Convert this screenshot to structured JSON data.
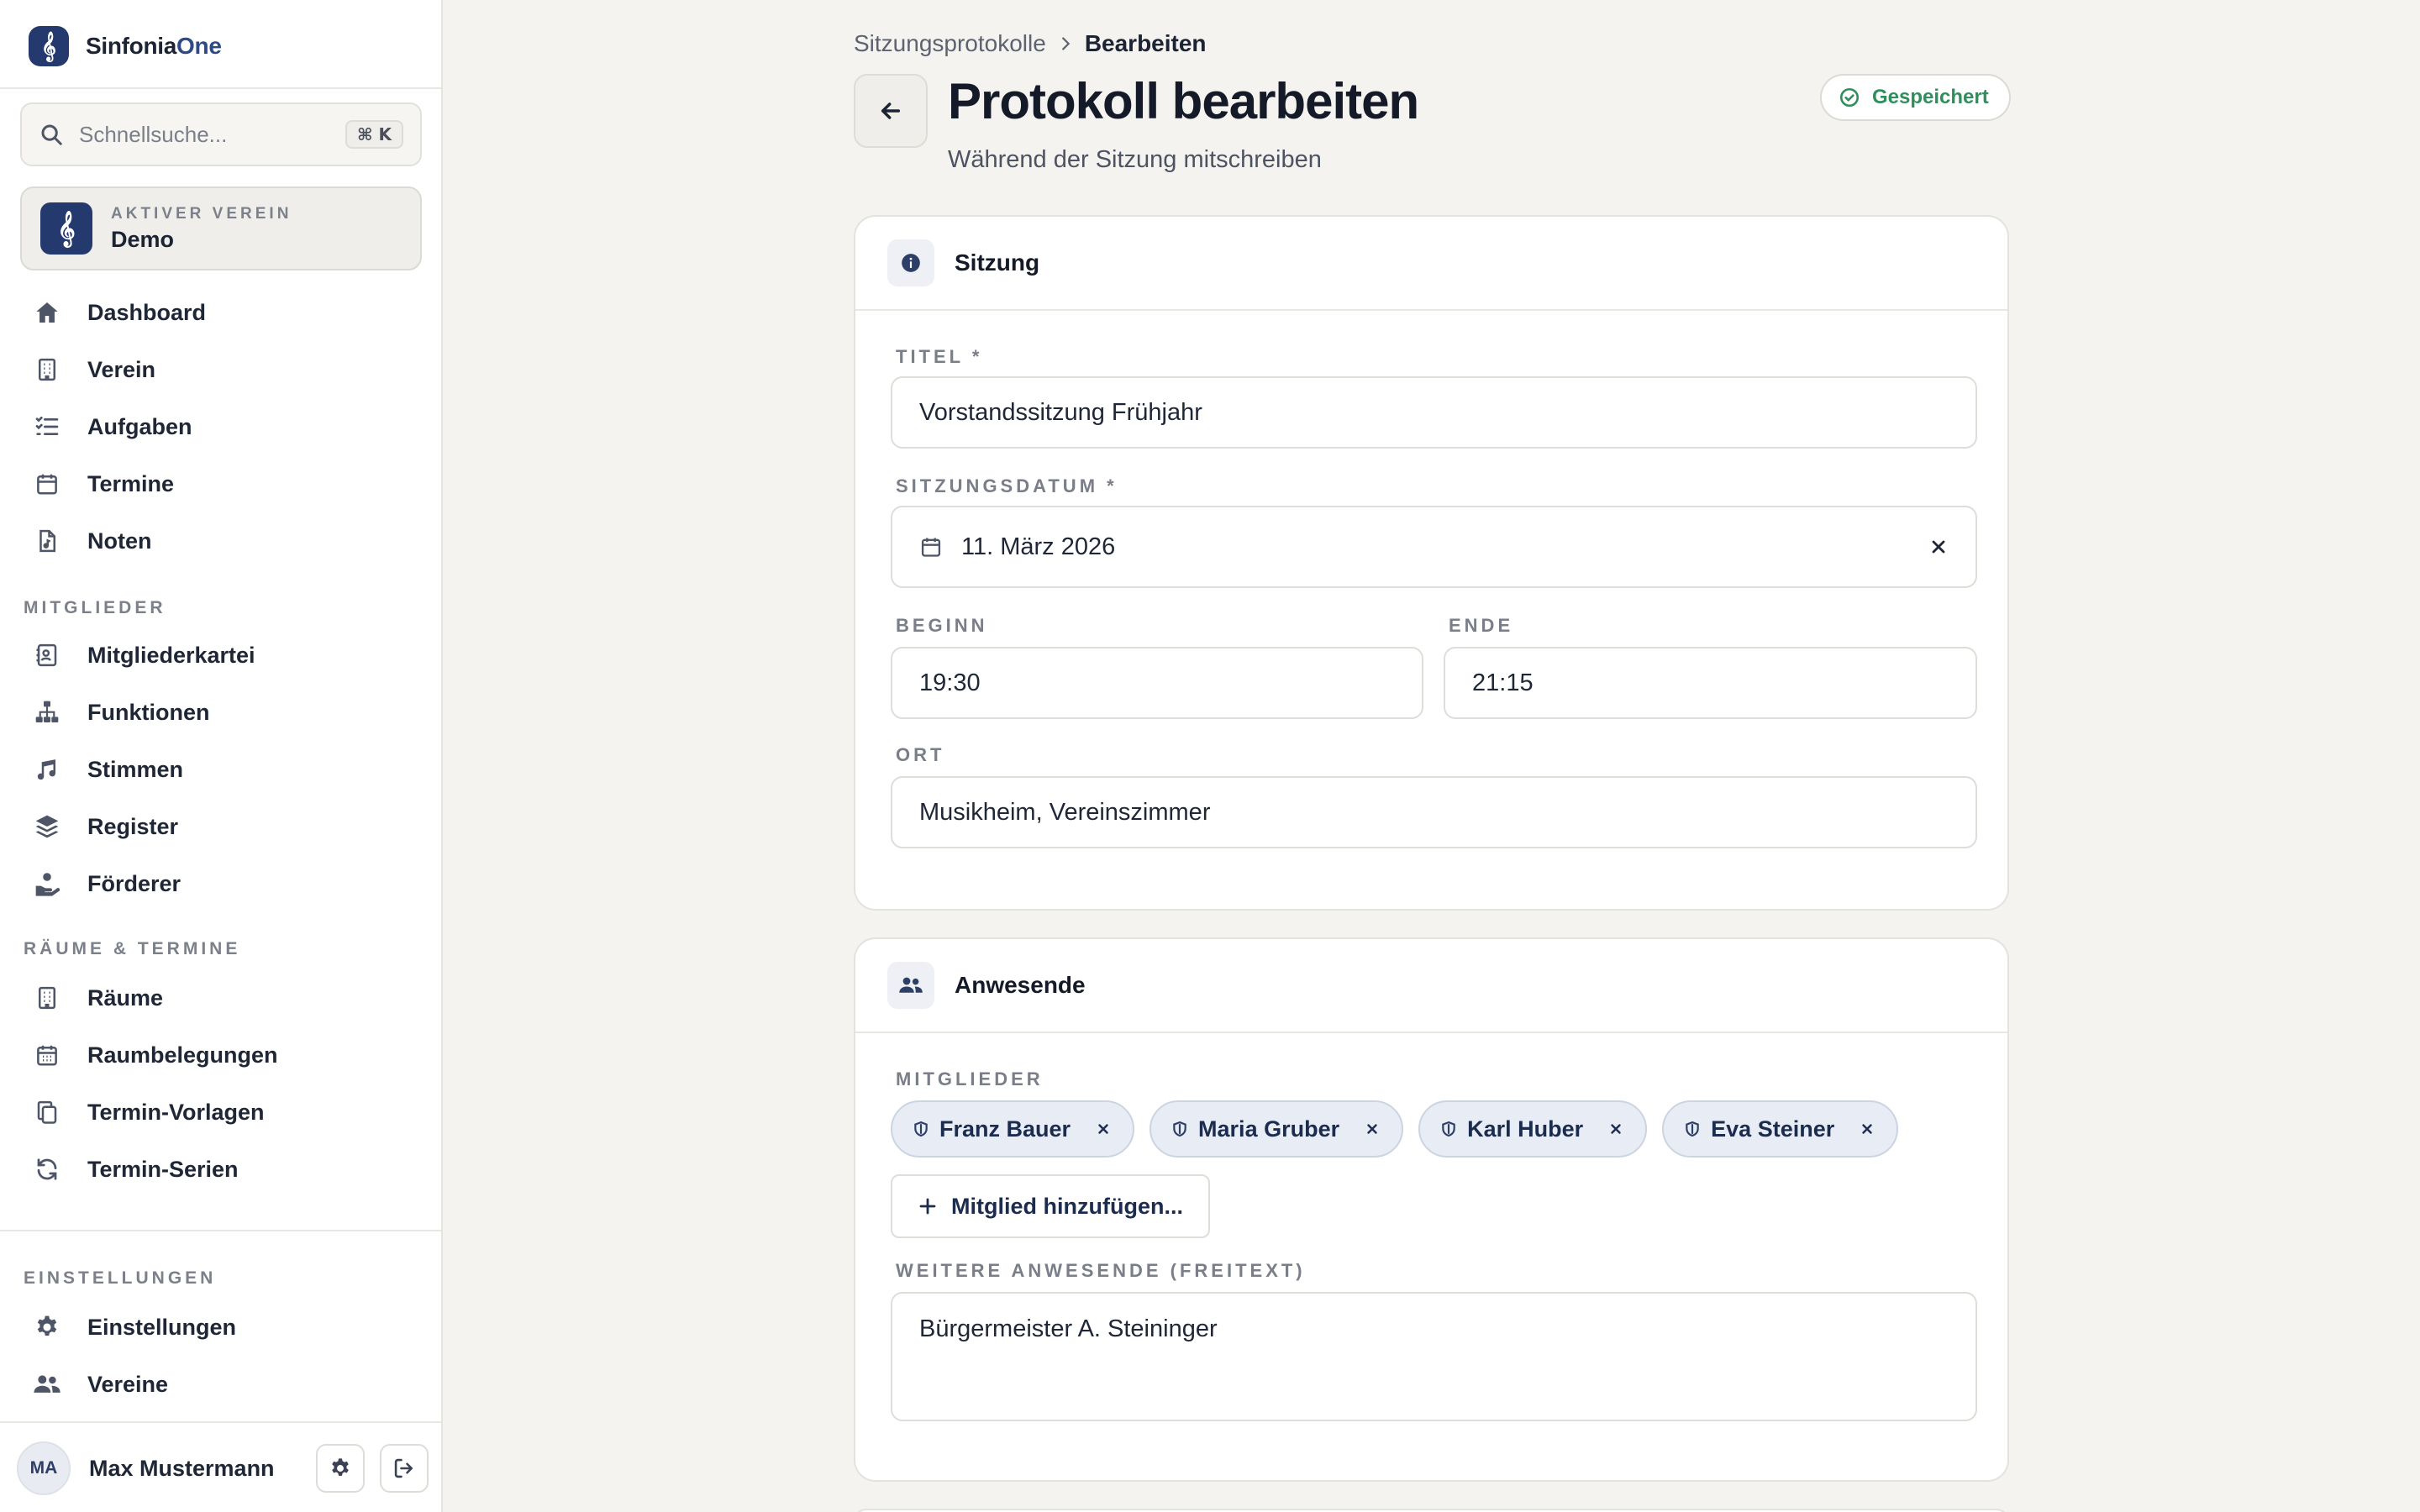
{
  "app": {
    "name_prefix": "Sinfonia",
    "name_accent": "One"
  },
  "search": {
    "placeholder": "Schnellsuche...",
    "shortcut": "⌘ K"
  },
  "club": {
    "label": "AKTIVER VEREIN",
    "name": "Demo"
  },
  "nav": {
    "main": [
      {
        "label": "Dashboard",
        "icon": "home-icon"
      },
      {
        "label": "Verein",
        "icon": "building-icon"
      },
      {
        "label": "Aufgaben",
        "icon": "task-list-icon"
      },
      {
        "label": "Termine",
        "icon": "calendar-icon"
      },
      {
        "label": "Noten",
        "icon": "sheet-music-file-icon"
      }
    ],
    "members_section": "MITGLIEDER",
    "members": [
      {
        "label": "Mitgliederkartei",
        "icon": "contact-card-icon"
      },
      {
        "label": "Funktionen",
        "icon": "org-chart-icon"
      },
      {
        "label": "Stimmen",
        "icon": "music-note-icon"
      },
      {
        "label": "Register",
        "icon": "layers-icon"
      },
      {
        "label": "Förderer",
        "icon": "donor-hand-icon"
      }
    ],
    "rooms_section": "RÄUME & TERMINE",
    "rooms": [
      {
        "label": "Räume",
        "icon": "building-icon"
      },
      {
        "label": "Raumbelegungen",
        "icon": "calendar-grid-icon"
      },
      {
        "label": "Termin-Vorlagen",
        "icon": "copy-icon"
      },
      {
        "label": "Termin-Serien",
        "icon": "refresh-icon"
      }
    ],
    "settings_section": "EINSTELLUNGEN",
    "settings": [
      {
        "label": "Einstellungen",
        "icon": "gear-icon"
      },
      {
        "label": "Vereine",
        "icon": "users-icon"
      }
    ]
  },
  "user": {
    "initials": "MA",
    "name": "Max Mustermann"
  },
  "breadcrumb": {
    "parent": "Sitzungsprotokolle",
    "current": "Bearbeiten"
  },
  "page": {
    "title": "Protokoll bearbeiten",
    "subtitle": "Während der Sitzung mitschreiben",
    "status": "Gespeichert"
  },
  "session": {
    "heading": "Sitzung",
    "title_label": "TITEL *",
    "title_value": "Vorstandssitzung Frühjahr",
    "date_label": "SITZUNGSDATUM *",
    "date_value": "11. März 2026",
    "start_label": "BEGINN",
    "start_value": "19:30",
    "end_label": "ENDE",
    "end_value": "21:15",
    "location_label": "ORT",
    "location_value": "Musikheim, Vereinszimmer"
  },
  "attendance": {
    "heading": "Anwesende",
    "members_label": "MITGLIEDER",
    "members": [
      "Franz Bauer",
      "Maria Gruber",
      "Karl Huber",
      "Eva Steiner"
    ],
    "add_label": "Mitglied hinzufügen...",
    "others_label": "WEITERE ANWESENDE (FREITEXT)",
    "others_value": "Bürgermeister A. Steininger"
  },
  "colors": {
    "brand": "#243a6e",
    "saved": "#2f8f5c",
    "background": "#f4f3f0"
  }
}
